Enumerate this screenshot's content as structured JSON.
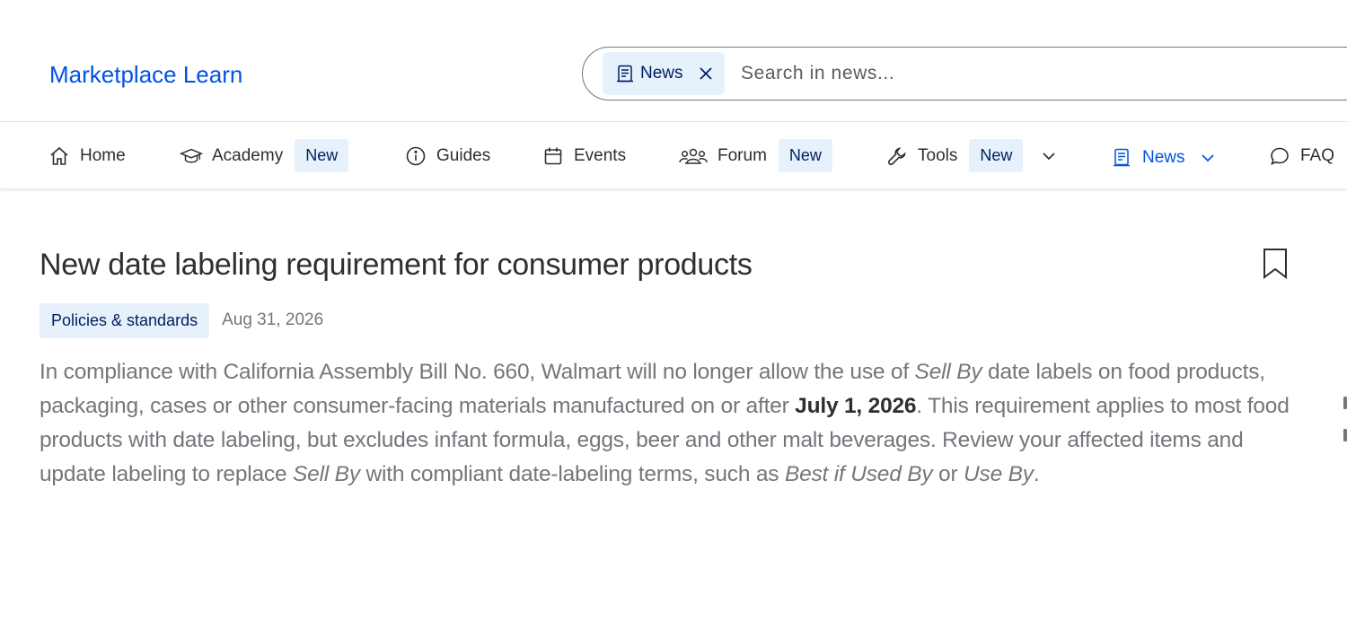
{
  "header": {
    "brand": "Marketplace Learn",
    "search": {
      "scope_label": "News",
      "placeholder": "Search in news..."
    }
  },
  "nav": {
    "items": [
      {
        "label": "Home",
        "icon": "home-icon"
      },
      {
        "label": "Academy",
        "icon": "graduation-cap-icon",
        "badge": "New"
      },
      {
        "label": "Guides",
        "icon": "info-icon"
      },
      {
        "label": "Events",
        "icon": "calendar-icon"
      },
      {
        "label": "Forum",
        "icon": "people-icon",
        "badge": "New"
      },
      {
        "label": "Tools",
        "icon": "wrench-icon",
        "badge": "New"
      },
      {
        "label": "News",
        "icon": "document-icon",
        "active": true
      },
      {
        "label": "FAQ",
        "icon": "chat-bubble-icon"
      }
    ]
  },
  "article": {
    "title": "New date labeling requirement for consumer products",
    "category": "Policies & standards",
    "date": "Aug 31, 2026",
    "body": {
      "p1": "In compliance with California Assembly Bill No. 660, Walmart will no longer allow the use of ",
      "sell_by_1": "Sell By",
      "p2": " date labels on food products, packaging, cases or other consumer-facing materials manufactured on or after ",
      "bold_date": "July 1, 2026",
      "p3": ". This requirement applies to most food products with date labeling, but excludes infant formula, eggs, beer and other malt beverages. Review your affected items and update labeling to replace ",
      "sell_by_2": "Sell By",
      "p4": " with compliant date-labeling terms, such as ",
      "best_if": "Best if Used By",
      "p5": " or ",
      "use_by": "Use By",
      "p6": "."
    }
  },
  "colors": {
    "brand": "#0053e2",
    "badge_bg": "#e6f1fc",
    "badge_text": "#001e60",
    "muted_text": "#74767c"
  }
}
